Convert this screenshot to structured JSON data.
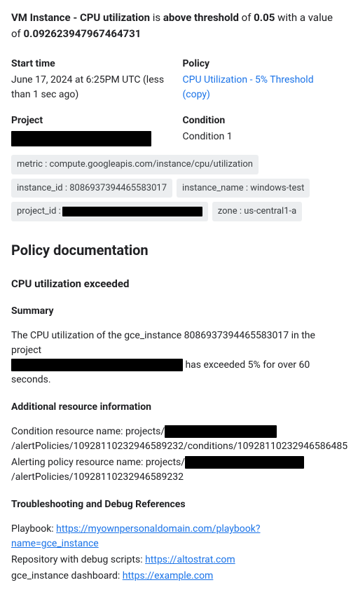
{
  "alert": {
    "subject_bold": "VM Instance - CPU utilization",
    "mid1": " is ",
    "state_bold": "above threshold",
    "mid2": " of ",
    "threshold_bold": "0.05",
    "mid3": " with a value of ",
    "value_bold": "0.092623947967464731"
  },
  "meta": {
    "start_time_label": "Start time",
    "start_time_value": "June 17, 2024 at 6:25PM UTC (less than 1 sec ago)",
    "policy_label": "Policy",
    "policy_link_text": "CPU Utilization - 5% Threshold (copy)",
    "project_label": "Project",
    "condition_label": "Condition",
    "condition_value": "Condition 1"
  },
  "chips": {
    "metric": "metric : compute.googleapis.com/instance/cpu/utilization",
    "instance_id": "instance_id : 8086937394465583017",
    "instance_name": "instance_name : windows-test",
    "project_id_prefix": "project_id : ",
    "zone": "zone : us-central1-a"
  },
  "doc": {
    "heading": "Policy documentation",
    "title": "CPU utilization exceeded",
    "summary_label": "Summary",
    "summary_before": "The CPU utilization of the gce_instance 8086937394465583017 in the project ",
    "summary_after": " has exceeded 5% for over 60 seconds.",
    "resinfo_label": "Additional resource information",
    "cond_res_before": "Condition resource name: projects/",
    "cond_res_after": "/alertPolicies/10928110232946589232/conditions/10928110232946586485",
    "alert_res_before": "Alerting policy resource name: projects/",
    "alert_res_after": "/alertPolicies/10928110232946589232",
    "troubleshoot_label": "Troubleshooting and Debug References",
    "playbook_label": "Playbook: ",
    "playbook_link": "https://myownpersonaldomain.com/playbook?name=gce_instance",
    "repo_label": "Repository with debug scripts: ",
    "repo_link": "https://altostrat.com",
    "dash_label": "gce_instance dashboard: ",
    "dash_link": "https://example.com"
  }
}
